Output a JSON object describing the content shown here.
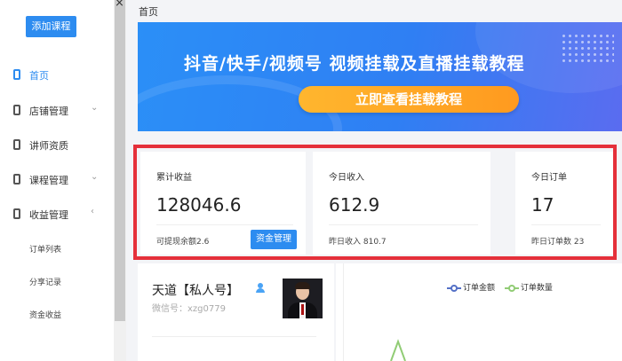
{
  "sidebar": {
    "add_course_label": "添加课程",
    "close_glyph": "×",
    "items": [
      {
        "label": "首页",
        "icon": "home-icon",
        "active": true,
        "chevron": ""
      },
      {
        "label": "店铺管理",
        "icon": "shop-icon",
        "active": false,
        "chevron": "⌄"
      },
      {
        "label": "讲师资质",
        "icon": "teacher-icon",
        "active": false,
        "chevron": ""
      },
      {
        "label": "课程管理",
        "icon": "course-icon",
        "active": false,
        "chevron": "⌄"
      },
      {
        "label": "收益管理",
        "icon": "income-icon",
        "active": false,
        "chevron": "‹"
      }
    ],
    "sub_items": [
      "订单列表",
      "分享记录",
      "资金收益"
    ]
  },
  "breadcrumb": "首页",
  "banner": {
    "title": "抖音/快手/视频号 视频挂载及直播挂载教程",
    "button_label": "立即查看挂载教程"
  },
  "stats": [
    {
      "label": "累计收益",
      "value": "128046.6",
      "foot": "可提现余额2.6",
      "button": "资金管理"
    },
    {
      "label": "今日收入",
      "value": "612.9",
      "foot": "昨日收入 810.7"
    },
    {
      "label": "今日订单",
      "value": "17",
      "foot": "昨日订单数 23"
    }
  ],
  "profile": {
    "name": "天道【私人号】",
    "wechat": "微信号：xzg0779"
  },
  "chart": {
    "legend": [
      {
        "name": "订单金额",
        "color": "#5470c6"
      },
      {
        "name": "订单数量",
        "color": "#91cc75"
      }
    ]
  }
}
